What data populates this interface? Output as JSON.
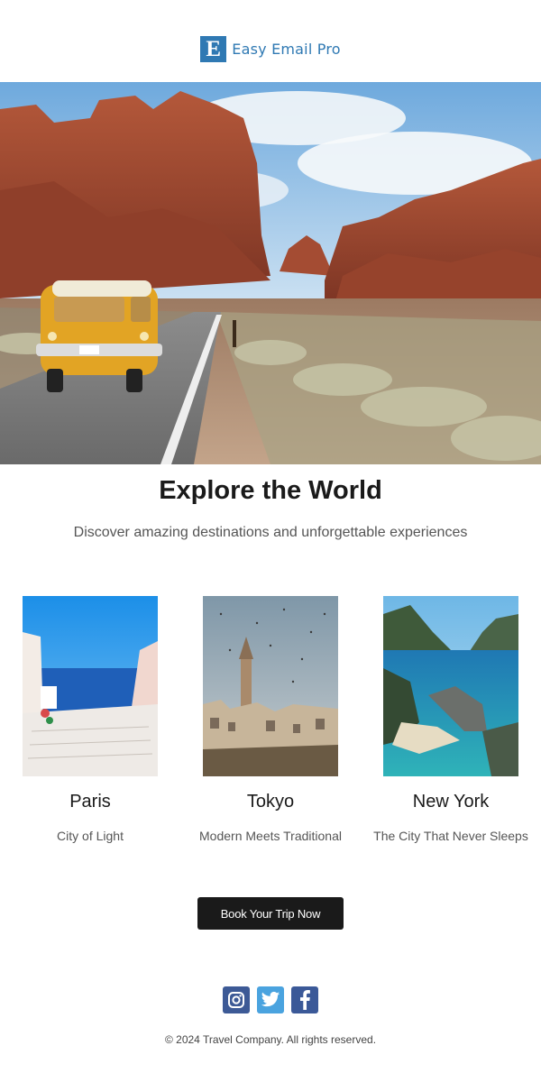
{
  "brand": {
    "logo_letter": "E",
    "name": "Easy Email Pro",
    "color": "#2f79b3"
  },
  "hero": {
    "image": "desert-road-van-photo"
  },
  "headline": "Explore the World",
  "subheadline": "Discover amazing destinations and unforgettable experiences",
  "destinations": [
    {
      "city": "Paris",
      "tagline": "City of Light",
      "image": "white-stairs-sea-photo"
    },
    {
      "city": "Tokyo",
      "tagline": "Modern Meets Traditional",
      "image": "city-tower-birds-photo"
    },
    {
      "city": "New York",
      "tagline": "The City That Never Sleeps",
      "image": "lagoon-cliffs-photo"
    }
  ],
  "cta": {
    "label": "Book Your Trip Now",
    "color": "#1a1a1a"
  },
  "social": [
    {
      "icon": "instagram-icon",
      "color": "#3d5a96"
    },
    {
      "icon": "twitter-icon",
      "color": "#4aa3df"
    },
    {
      "icon": "facebook-icon",
      "color": "#3b5998"
    }
  ],
  "footer": "© 2024 Travel Company. All rights reserved."
}
